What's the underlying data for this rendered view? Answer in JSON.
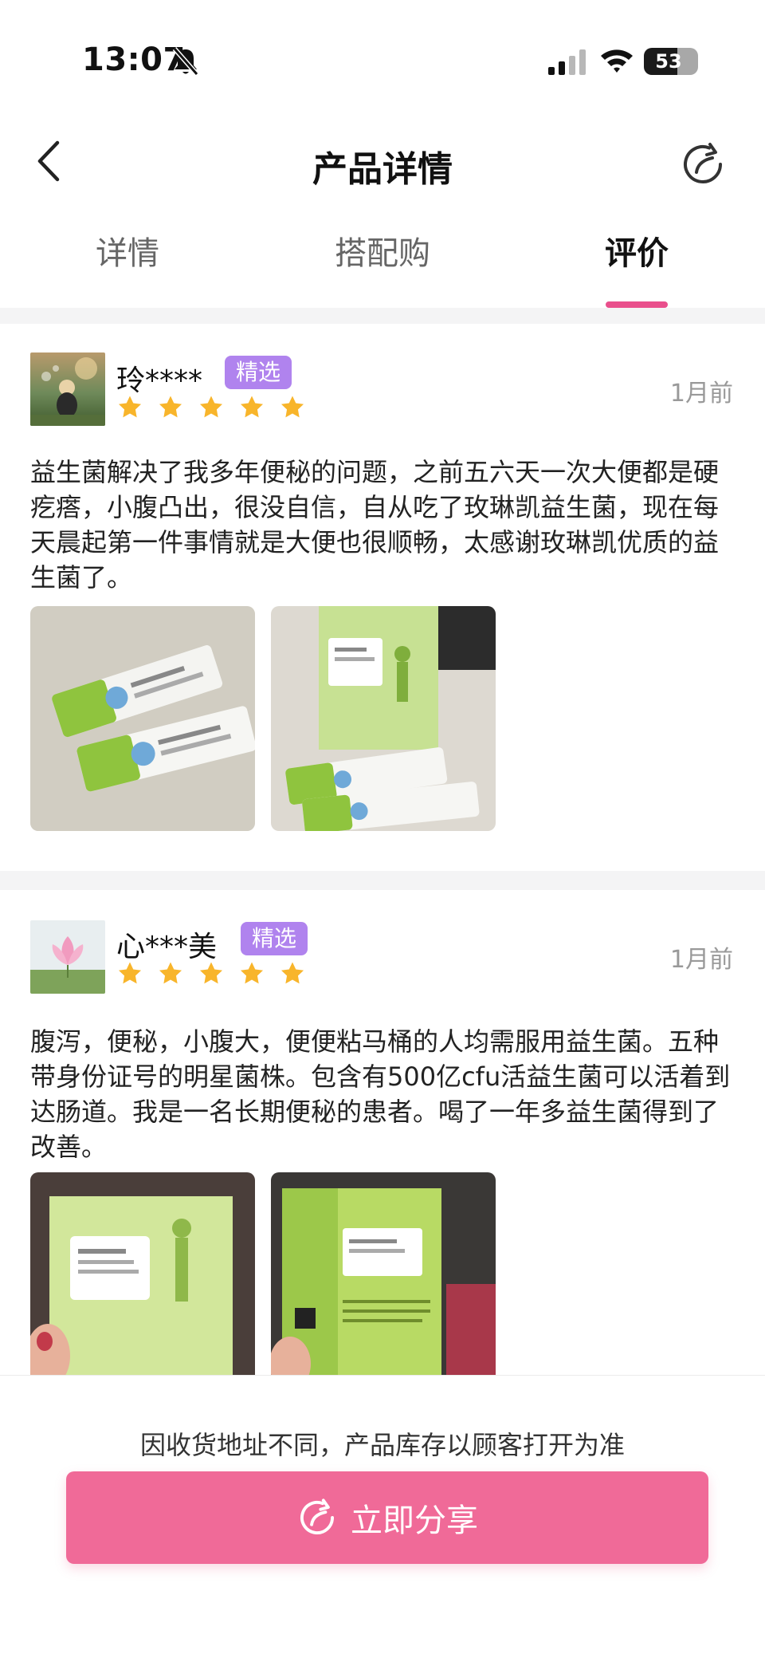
{
  "status_bar": {
    "time": "13:07",
    "battery": "53"
  },
  "header": {
    "title": "产品详情"
  },
  "tabs": [
    {
      "label": "详情"
    },
    {
      "label": "搭配购"
    },
    {
      "label": "评价"
    }
  ],
  "active_tab": "评价",
  "reviews": [
    {
      "name": "玲****",
      "badge": "精选",
      "rating": 5,
      "time": "1月前",
      "text": "益生菌解决了我多年便秘的问题，之前五六天一次大便都是硬疙瘩，小腹凸出，很没自信，自从吃了玫琳凯益生菌，现在每天晨起第一件事情就是大便也很顺畅，太感谢玫琳凯优质的益生菌了。"
    },
    {
      "name": "心***美",
      "badge": "精选",
      "rating": 5,
      "time": "1月前",
      "text": "腹泻，便秘，小腹大，便便粘马桶的人均需服用益生菌。五种带身份证号的明星菌株。包含有500亿cfu活益生菌可以活着到达肠道。我是一名长期便秘的患者。喝了一年多益生菌得到了改善。"
    }
  ],
  "bottom": {
    "notice": "因收货地址不同，产品库存以顾客打开为准",
    "share_button": "立即分享"
  },
  "colors": {
    "accent": "#e94f8c",
    "button": "#f06a98",
    "badge": "#b083ee",
    "star": "#f8b52b"
  }
}
